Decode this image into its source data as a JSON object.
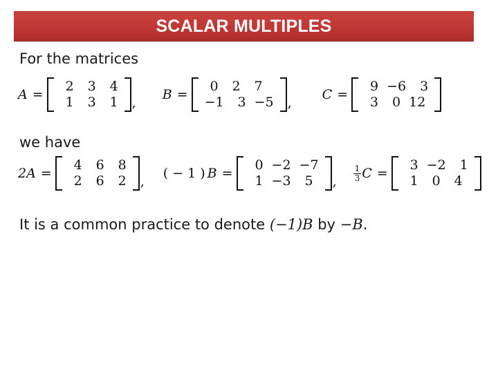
{
  "slide": {
    "title": "SCALAR MULTIPLES",
    "accent_color": "#c2372f",
    "title_text_color": "#ffffff",
    "background_color": "#ffffff",
    "body_text_color": "#1a1a1a"
  },
  "body": {
    "intro_line": "For the matrices",
    "result_line": "we have",
    "closing_line": {
      "before": "It is a common practice to denote ",
      "math_1": "(−1)B",
      "middle": " by ",
      "math_2": "−B",
      "after": "."
    }
  },
  "definitions": [
    {
      "name": "matrix-A",
      "lhs": "A",
      "equals": "=",
      "rows": [
        [
          "2",
          "3",
          "4"
        ],
        [
          "1",
          "3",
          "1"
        ]
      ],
      "trailing": ","
    },
    {
      "name": "matrix-B",
      "lhs": "B",
      "equals": "=",
      "rows": [
        [
          "0",
          "2",
          "7"
        ],
        [
          "−1",
          "3",
          "−5"
        ]
      ],
      "trailing": ","
    },
    {
      "name": "matrix-C",
      "lhs": "C",
      "equals": "=",
      "rows": [
        [
          "9",
          "−6",
          "3"
        ],
        [
          "3",
          "0",
          "12"
        ]
      ],
      "trailing": ""
    }
  ],
  "results": [
    {
      "name": "two-times-A",
      "lhs": "2A",
      "equals": "=",
      "rows": [
        [
          "4",
          "6",
          "8"
        ],
        [
          "2",
          "6",
          "2"
        ]
      ],
      "trailing": ","
    },
    {
      "name": "negative-one-times-B",
      "lhs_open": "(",
      "lhs_op": "−",
      "lhs_num": "1",
      "lhs_close": ")",
      "lhs_var": "B",
      "equals": "=",
      "rows": [
        [
          "0",
          "−2",
          "−7"
        ],
        [
          "1",
          "−3",
          "5"
        ]
      ],
      "trailing": ","
    },
    {
      "name": "one-third-times-C",
      "frac_numerator": "1",
      "frac_denominator": "3",
      "lhs_var": "C",
      "equals": "=",
      "rows": [
        [
          "3",
          "−2",
          "1"
        ],
        [
          "1",
          "0",
          "4"
        ]
      ],
      "trailing": ""
    }
  ]
}
